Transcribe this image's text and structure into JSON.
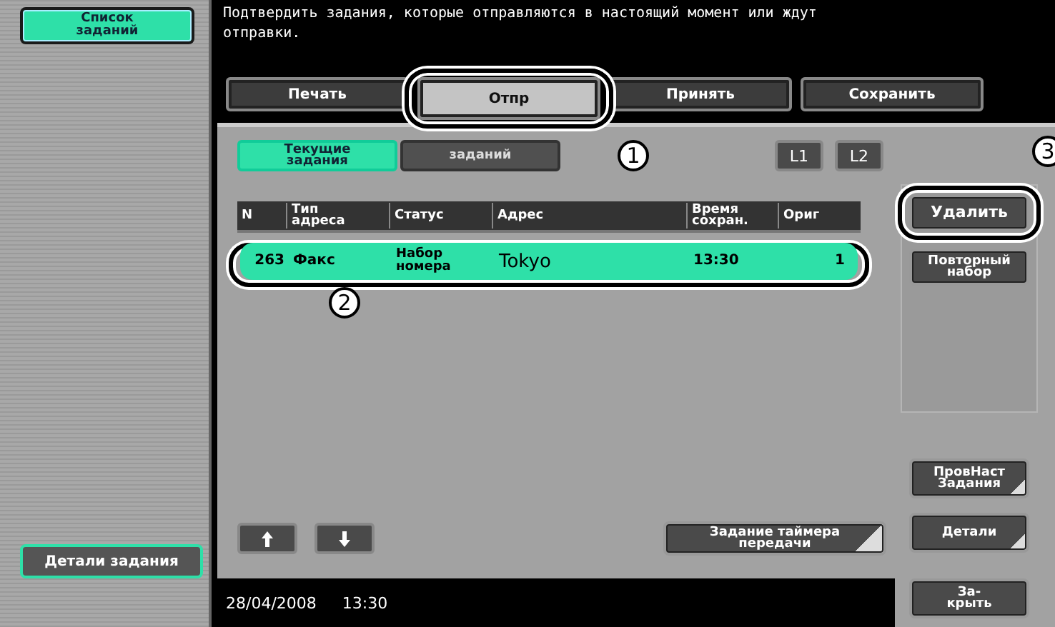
{
  "sidebar": {
    "buttons": [
      {
        "label": "Список\nзаданий",
        "kind": "top",
        "selected": true
      },
      {
        "label": "Детали задания",
        "kind": "bottom",
        "selected": false
      }
    ]
  },
  "message": "Подтвердить задания, которые отправляются в настоящий момент или ждут\nотправки.",
  "tabs": [
    {
      "label": "Печать",
      "selected": false
    },
    {
      "label": "Отпр",
      "selected": true
    },
    {
      "label": "Принять",
      "selected": false
    },
    {
      "label": "Сохранить",
      "selected": false
    }
  ],
  "subtabs": [
    {
      "label": "Текущие\nзадания",
      "selected": true
    },
    {
      "label": "заданий",
      "selected": false
    }
  ],
  "line_buttons": [
    "L1",
    "L2"
  ],
  "table": {
    "columns": [
      "N",
      "Тип\nадреса",
      "Статус",
      "Адрес",
      "Время\nсохран.",
      "Ориг"
    ],
    "rows": [
      {
        "cells": [
          "263",
          "Факс",
          "Набор\nномера",
          "Tokyo",
          "13:30",
          "1"
        ],
        "selected": true
      }
    ]
  },
  "timer_button": "Задание таймера\nпередачи",
  "side_buttons": [
    {
      "label": "Удалить",
      "kind": "action"
    },
    {
      "label": "Повторный\nнабор",
      "kind": "action"
    },
    {
      "label": "ПровНаст\nЗадания",
      "kind": "menu"
    },
    {
      "label": "Детали",
      "kind": "menu"
    },
    {
      "label": "За-\nкрыть",
      "kind": "close"
    }
  ],
  "status_bar": {
    "date": "28/04/2008",
    "time": "13:30"
  },
  "callouts": [
    "1",
    "2",
    "3"
  ]
}
